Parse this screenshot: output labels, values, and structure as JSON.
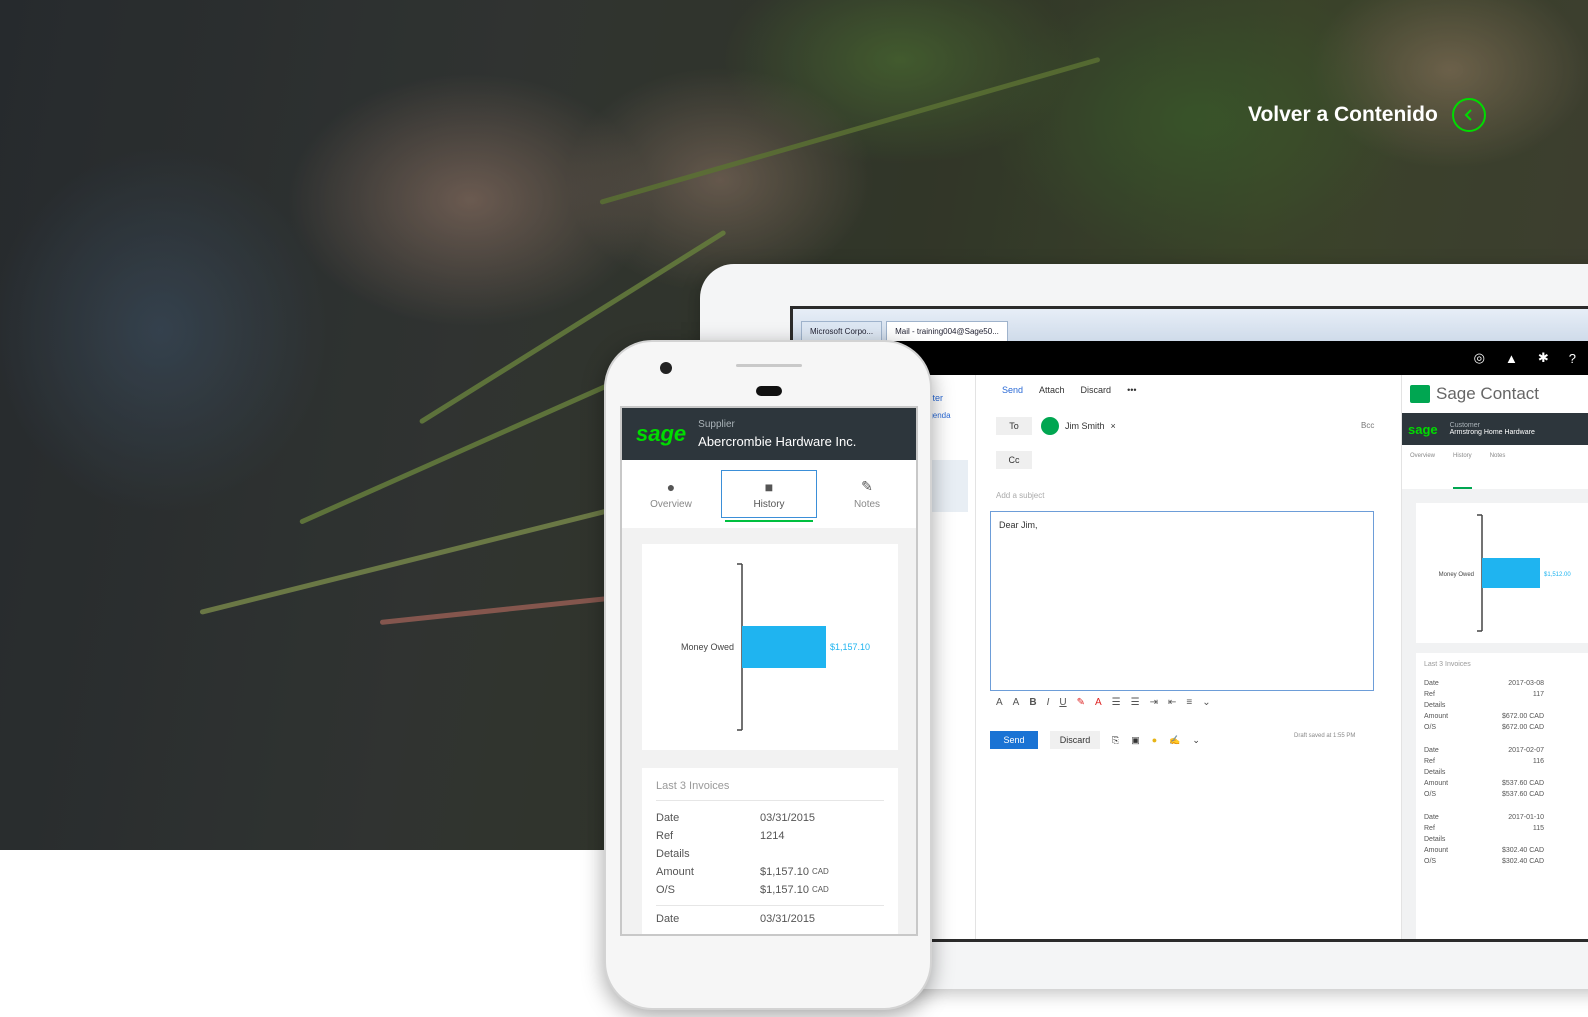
{
  "hero": {
    "back_link_label": "Volver a Contenido"
  },
  "phone": {
    "brand": "sage",
    "entity_type": "Supplier",
    "entity_name": "Abercrombie Hardware Inc.",
    "tabs": [
      {
        "label": "Overview"
      },
      {
        "label": "History",
        "active": true
      },
      {
        "label": "Notes"
      }
    ],
    "chart_data": {
      "type": "bar",
      "orientation": "horizontal",
      "categories": [
        "Money Owed"
      ],
      "values": [
        1157.1
      ],
      "data_labels": [
        "$1,157.10"
      ]
    },
    "invoices": {
      "title": "Last 3 Invoices",
      "records": [
        {
          "date_label": "Date",
          "date": "03/31/2015",
          "ref_label": "Ref",
          "ref": "1214",
          "details_label": "Details",
          "amount_label": "Amount",
          "amount": "$1,157.10",
          "amount_currency": "CAD",
          "os_label": "O/S",
          "os": "$1,157.10",
          "os_currency": "CAD"
        },
        {
          "date_label": "Date",
          "date": "03/31/2015"
        }
      ]
    }
  },
  "desktop": {
    "browser_tabs": [
      "Microsoft Corpo...",
      "Mail - training004@Sage50..."
    ],
    "compose": {
      "toolbar": {
        "send": "Send",
        "attach": "Attach",
        "discard": "Discard",
        "more": "•••"
      },
      "to_label": "To",
      "recipient": "Jim Smith",
      "cc_label": "Cc",
      "bcc_label": "Bcc",
      "subject_placeholder": "Add a subject",
      "body": "Dear Jim,",
      "send_button": "Send",
      "discard_button": "Discard",
      "draft_note": "Draft saved at 1:55 PM"
    },
    "mail_list": {
      "filter": "Filter",
      "agenda": "Agenda"
    },
    "sidebar": {
      "title": "Sage Contact",
      "brand": "sage",
      "entity_type": "Customer",
      "entity_name": "Armstrong Home Hardware",
      "tabs": [
        "Overview",
        "History",
        "Notes"
      ],
      "chart_data": {
        "type": "bar",
        "orientation": "horizontal",
        "categories": [
          "Money Owed"
        ],
        "values": [
          1.0
        ],
        "data_labels": [
          "$1,512.00"
        ]
      },
      "invoices_title": "Last 3 Invoices",
      "invoices": [
        {
          "date": "2017-03-08",
          "ref": "117",
          "amount": "$672.00 CAD",
          "os": "$672.00 CAD"
        },
        {
          "date": "2017-02-07",
          "ref": "116",
          "amount": "$537.60 CAD",
          "os": "$537.60 CAD"
        },
        {
          "date": "2017-01-10",
          "ref": "115",
          "amount": "$302.40 CAD",
          "os": "$302.40 CAD"
        }
      ],
      "row_labels": {
        "date": "Date",
        "ref": "Ref",
        "details": "Details",
        "amount": "Amount",
        "os": "O/S"
      }
    }
  },
  "colors": {
    "sage_green": "#00dc00",
    "header_dark": "#2d363c",
    "bar_blue": "#1fb4f0",
    "link_blue": "#2a6ad6"
  }
}
